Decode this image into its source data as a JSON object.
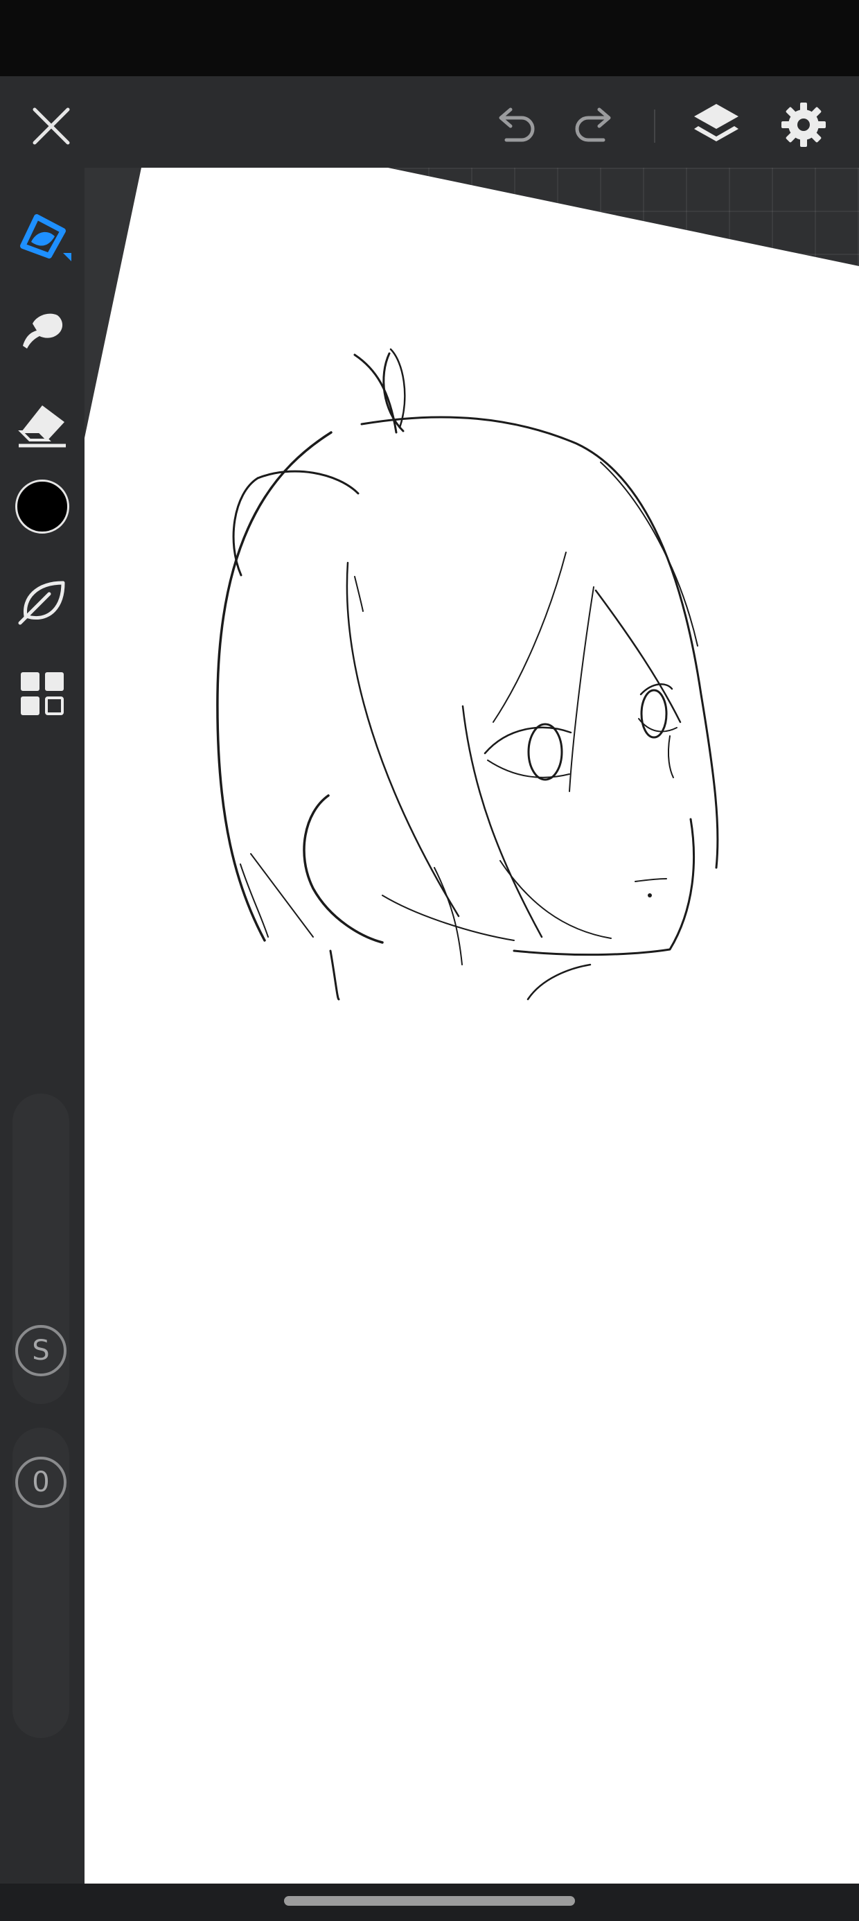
{
  "toolbar": {
    "close_icon": "close-icon",
    "undo_icon": "undo-icon",
    "redo_icon": "redo-icon",
    "layers_icon": "layers-icon",
    "settings_icon": "gear-icon"
  },
  "tools": {
    "brush_icon": "pen-brush-icon",
    "smudge_icon": "smudge-icon",
    "eraser_icon": "eraser-icon",
    "color": "#000000",
    "stabilizer_icon": "leaf-icon",
    "grid_icon": "quick-menu-grid-icon",
    "active_color": "#1e90ff"
  },
  "sliders": {
    "size_label": "S",
    "opacity_label": "0"
  }
}
